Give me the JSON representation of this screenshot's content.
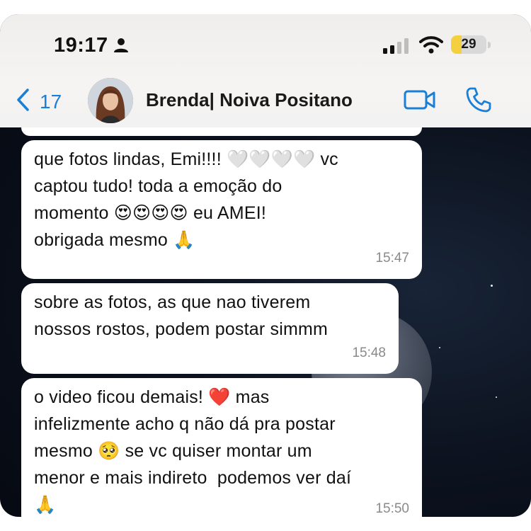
{
  "status_bar": {
    "time": "19:17",
    "battery_level": "29",
    "battery_fraction": 0.29,
    "icons": [
      "person-icon",
      "cellular-signal-icon",
      "wifi-icon",
      "battery-icon"
    ]
  },
  "chat_header": {
    "back_count": "17",
    "contact_name": "Brenda| Noiva Positano",
    "icons": [
      "chevron-left-icon",
      "avatar",
      "video-call-icon",
      "phone-call-icon"
    ],
    "accent_color": "#1a7fd6"
  },
  "messages": [
    {
      "text": "que fotos lindas, Emi!!!! 🤍🤍🤍🤍 vc\ncaptou tudo! toda a emoção do\nmomento 😍😍😍😍 eu AMEI!\nobrigada mesmo 🙏",
      "time": "15:47"
    },
    {
      "text": "sobre as fotos, as que nao tiverem\nnossos rostos, podem postar simmm",
      "time": "15:48"
    },
    {
      "text": "o video ficou demais! ❤️ mas\ninfelizmente acho q não dá pra postar\nmesmo 🥺 se vc quiser montar um\nmenor e mais indireto  podemos ver daí\n🙏",
      "time": "15:50"
    }
  ]
}
